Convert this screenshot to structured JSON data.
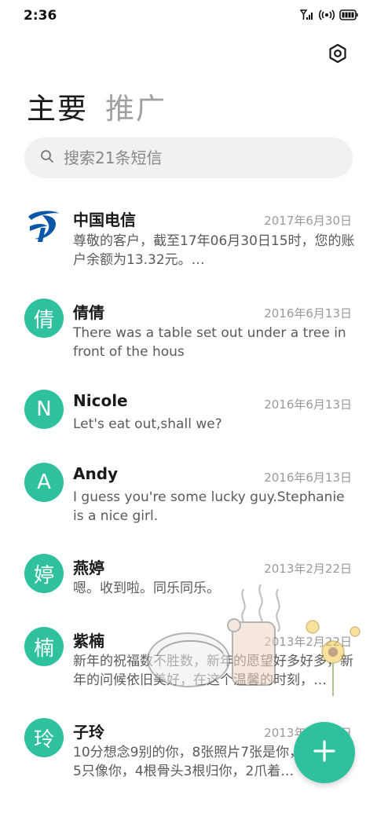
{
  "status_bar": {
    "time": "2:36"
  },
  "tabs": [
    {
      "label": "主要"
    },
    {
      "label": "推广"
    }
  ],
  "search": {
    "placeholder": "搜索21条短信"
  },
  "conversations": [
    {
      "avatar": "",
      "name": "中国电信",
      "date": "2017年6月30日",
      "preview": "尊敬的客户，截至17年06月30日15时，您的账户余额为13.32元。…"
    },
    {
      "avatar": "倩",
      "name": "倩倩",
      "date": "2016年6月13日",
      "preview": "There was a table set out under a tree in front of the hous"
    },
    {
      "avatar": "N",
      "name": "Nicole",
      "date": "2016年6月13日",
      "preview": "Let's eat out,shall we?"
    },
    {
      "avatar": "A",
      "name": "Andy",
      "date": "2016年6月13日",
      "preview": "I guess you're some lucky guy.Stephanie is a nice girl."
    },
    {
      "avatar": "婷",
      "name": "燕婷",
      "date": "2013年2月22日",
      "preview": "嗯。收到啦。同乐同乐。"
    },
    {
      "avatar": "楠",
      "name": "紫楠",
      "date": "2013年2月22日",
      "preview": "新年的祝福数不胜数，新年的愿望好多好多，新年的问候依旧美好，在这个温馨的时刻，…"
    },
    {
      "avatar": "玲",
      "name": "子玲",
      "date": "2013年2月22日",
      "preview": "10分想念9别的你，8张照片7张是你，6只小狗5只像你，4根骨头3根归你，2爪着…"
    }
  ],
  "icons": {
    "settings": "gear-icon",
    "search": "search-icon",
    "compose": "plus-icon"
  },
  "colors": {
    "accent": "#2fc19e",
    "telecom_logo": "#0a56a8"
  }
}
